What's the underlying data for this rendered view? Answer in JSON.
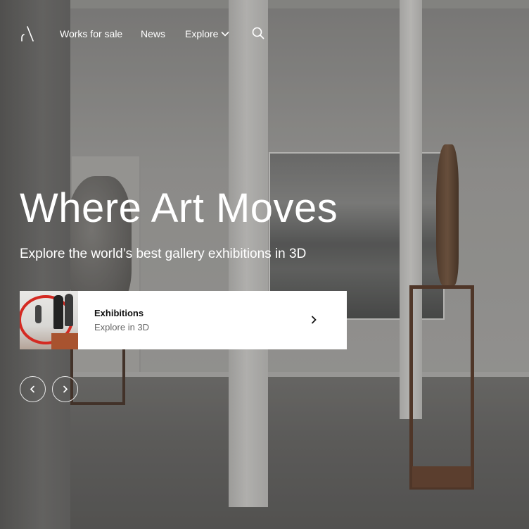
{
  "nav": {
    "logo_icon": "artland-logo-icon",
    "works_label": "Works for sale",
    "news_label": "News",
    "explore_label": "Explore",
    "explore_icon": "chevron-down-icon",
    "search_icon": "search-icon"
  },
  "hero": {
    "title": "Where Art Moves",
    "subtitle": "Explore the world’s best gallery exhibitions in 3D"
  },
  "card": {
    "title": "Exhibitions",
    "subtitle": "Explore in 3D",
    "arrow_icon": "chevron-right-icon"
  },
  "carousel": {
    "prev_icon": "chevron-left-icon",
    "next_icon": "chevron-right-icon"
  },
  "colors": {
    "text": "#ffffff",
    "card_background": "#ffffff",
    "card_title": "#111111",
    "card_subtitle": "#666666",
    "thumbnail_accent": "#d42a22"
  }
}
